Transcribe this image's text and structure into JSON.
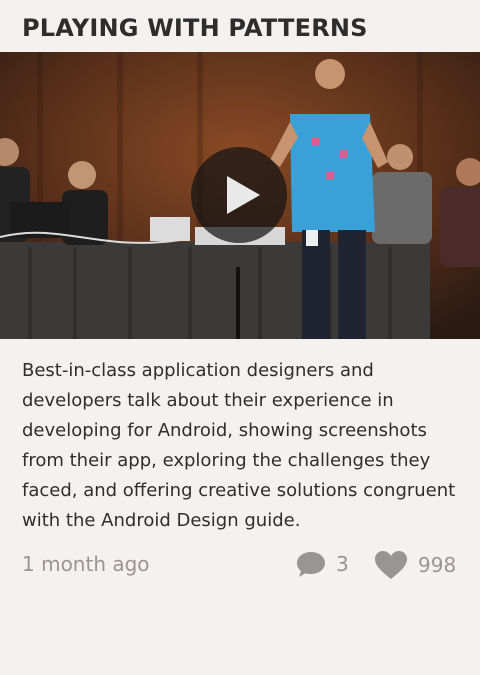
{
  "card": {
    "title": "PLAYING WITH PATTERNS",
    "description": "Best-in-class application designers and developers talk about their experience in developing for Android, showing screenshots from their app, exploring the challenges they faced, and offering creative solutions congruent with the Android Design guide.",
    "posted": "1 month ago",
    "comment_count": "3",
    "like_count": "998"
  },
  "video": {
    "play_icon": "play-icon"
  },
  "icons": {
    "comment": "comment-bubble-icon",
    "like": "heart-icon"
  },
  "colors": {
    "background": "#f5f1ee",
    "meta_text": "#9a9595",
    "shirt": "#3aa0d8"
  }
}
